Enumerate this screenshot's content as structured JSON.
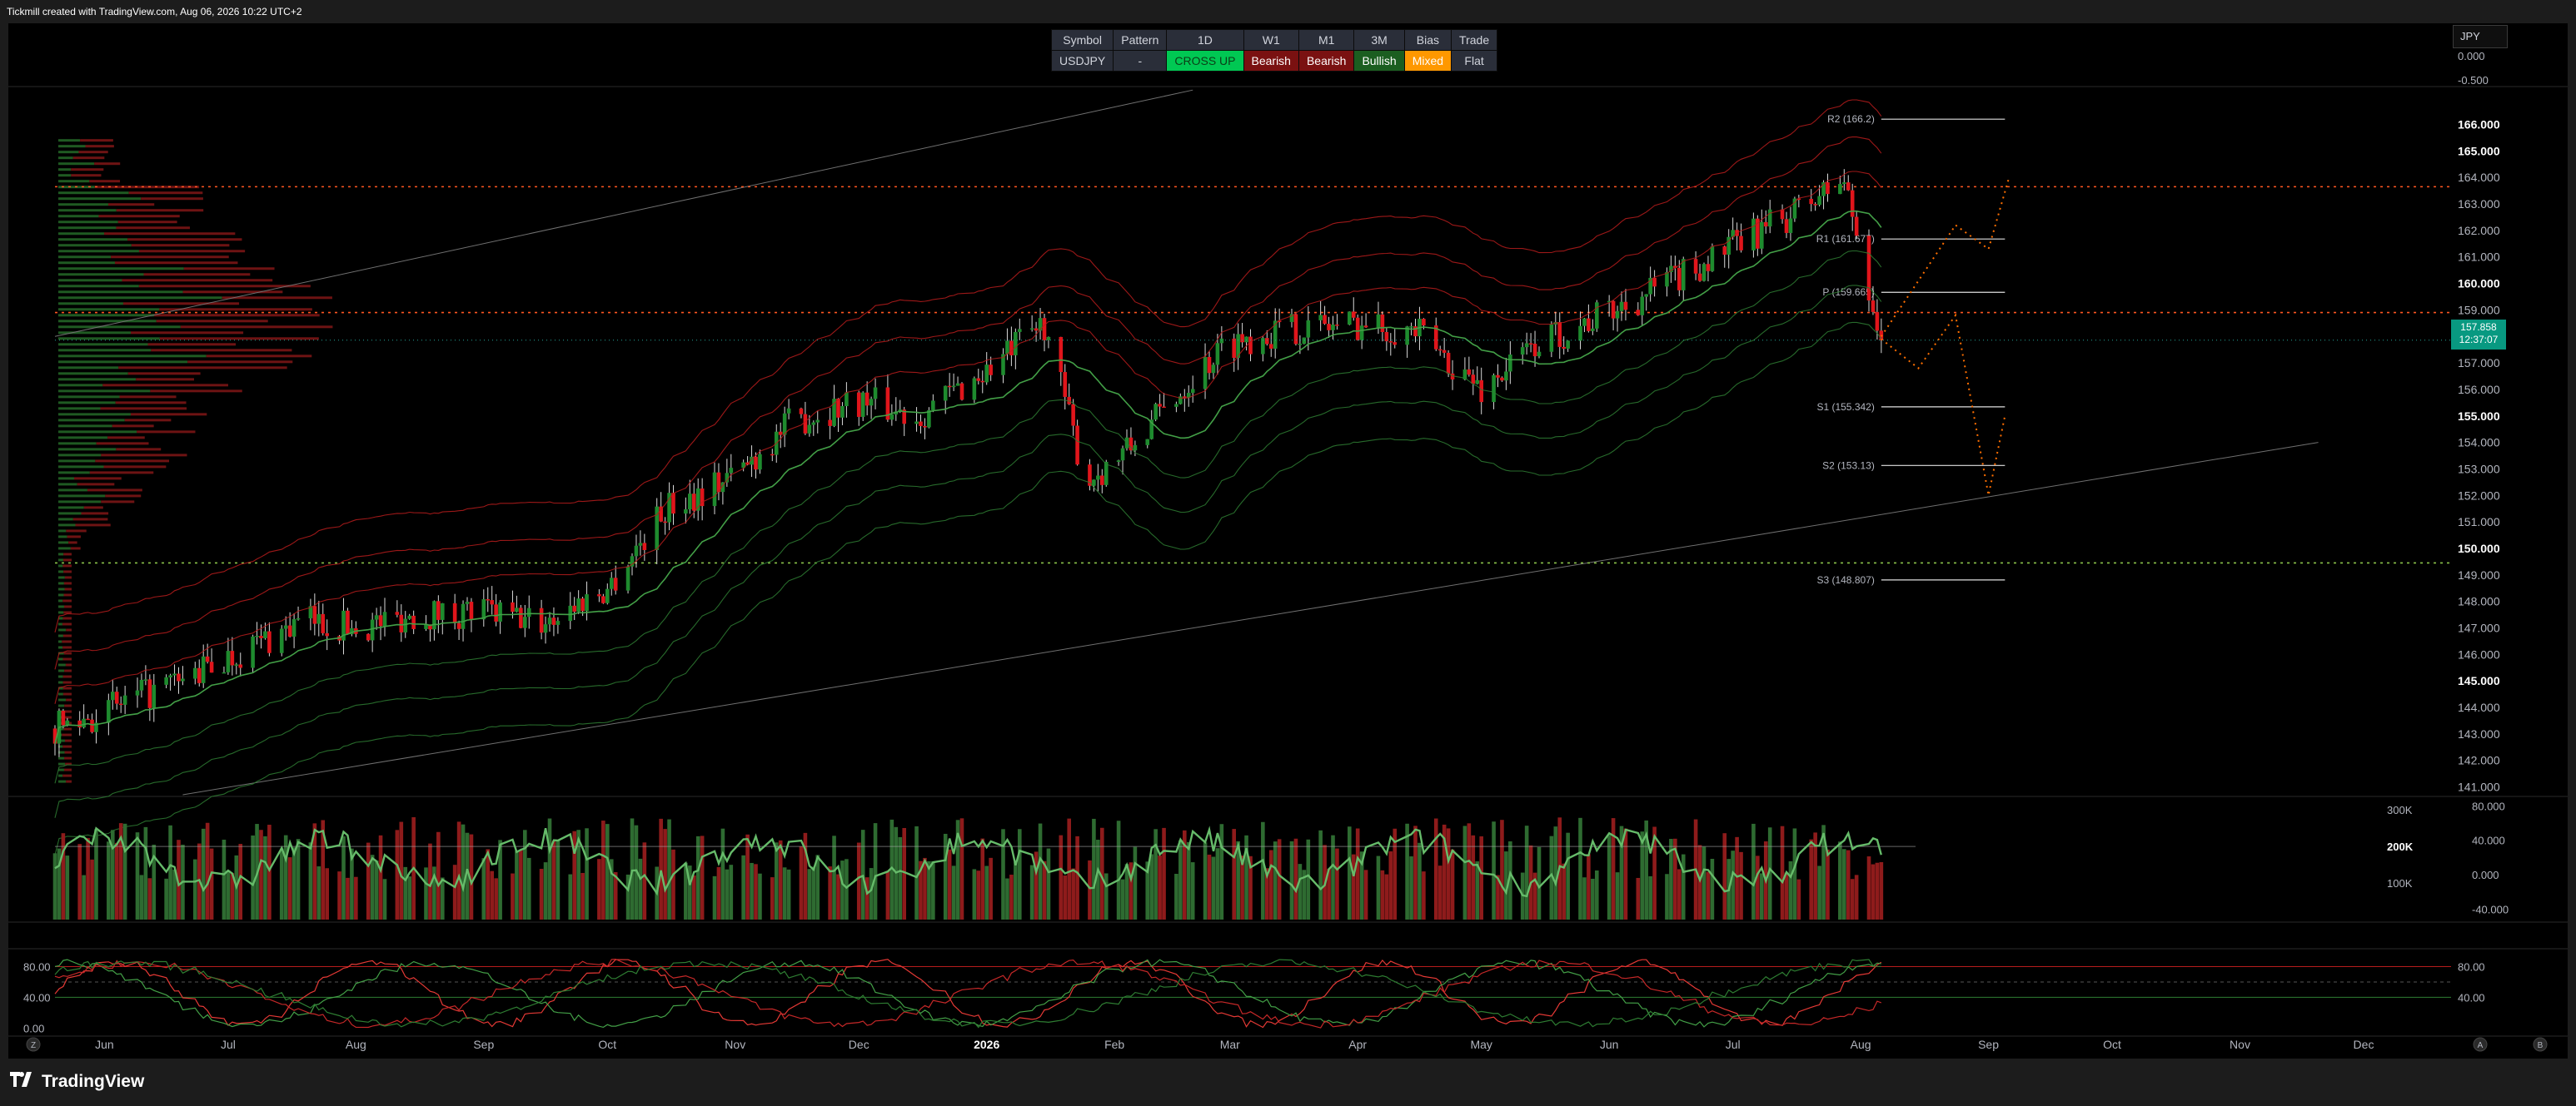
{
  "header": {
    "caption": "Tickmill created with TradingView.com, Aug 06, 2026 10:22 UTC+2"
  },
  "footer": {
    "brand": "TradingView"
  },
  "summary_table": {
    "headers": [
      "Symbol",
      "Pattern",
      "1D",
      "W1",
      "M1",
      "3M",
      "Bias",
      "Trade"
    ],
    "row": [
      "USDJPY",
      "-",
      "CROSS UP",
      "Bearish",
      "Bearish",
      "Bullish",
      "Mixed",
      "Flat"
    ],
    "cell_colors": [
      "#2a2e39",
      "#2a2e39",
      "#00c853",
      "#7a1111",
      "#7a1111",
      "#1b5e20",
      "#ff9800",
      "#2a2e39"
    ],
    "cell_text_colors": [
      "#d1d4dc",
      "#d1d4dc",
      "#0b3d17",
      "#ffffff",
      "#ffffff",
      "#ffffff",
      "#ffffff",
      "#d1d4dc"
    ]
  },
  "currency_label": "JPY",
  "price_tag": {
    "price": "157.858",
    "countdown": "12:37:07"
  },
  "colors": {
    "background": "#000000",
    "bull": "#26a69a",
    "candle_up": "#1e8b2e",
    "candle_down": "#e0151b",
    "band_red": "#b71c1c",
    "band_green": "#2e7d32",
    "resistance_line": "#ff5722",
    "support_line": "#8bc34a",
    "projection": "#ff6f00"
  },
  "chart_data": [
    {
      "type": "candlestick",
      "symbol": "USDJPY",
      "timeframe": "1D",
      "x_ticks": [
        "Jun",
        "Jul",
        "Aug",
        "Sep",
        "Oct",
        "Nov",
        "Dec",
        "2026",
        "Feb",
        "Mar",
        "Apr",
        "May",
        "Jun",
        "Jul",
        "Aug",
        "Sep",
        "Oct",
        "Nov",
        "Dec"
      ],
      "y_ticks": [
        "166.000",
        "165.000",
        "164.000",
        "163.000",
        "162.000",
        "161.000",
        "160.000",
        "159.000",
        "158.000",
        "157.000",
        "156.000",
        "155.000",
        "154.000",
        "153.000",
        "152.000",
        "151.000",
        "150.000",
        "149.000",
        "148.000",
        "147.000",
        "146.000",
        "145.000",
        "144.000",
        "143.000",
        "142.000",
        "141.000"
      ],
      "y_tick_values": [
        166,
        165,
        164,
        163,
        162,
        161,
        160,
        159,
        158,
        157,
        156,
        155,
        154,
        153,
        152,
        151,
        150,
        149,
        148,
        147,
        146,
        145,
        144,
        143,
        142,
        141
      ],
      "y_tick_bold": [
        166.0,
        165.0,
        160.0,
        155.0,
        150.0,
        145.0
      ],
      "ylim": [
        140.7,
        167.4
      ],
      "price_path": {
        "dates": [
          "2025-05-20",
          "2025-06-05",
          "2025-06-20",
          "2025-07-05",
          "2025-07-20",
          "2025-08-01",
          "2025-08-15",
          "2025-09-01",
          "2025-09-15",
          "2025-10-01",
          "2025-10-15",
          "2025-11-01",
          "2025-11-15",
          "2025-12-01",
          "2025-12-15",
          "2026-01-01",
          "2026-01-15",
          "2026-01-25",
          "2026-02-05",
          "2026-02-20",
          "2026-03-01",
          "2026-03-15",
          "2026-04-01",
          "2026-04-15",
          "2026-05-01",
          "2026-05-15",
          "2026-06-01",
          "2026-06-15",
          "2026-07-01",
          "2026-07-15",
          "2026-07-28",
          "2026-08-06"
        ],
        "close": [
          143.2,
          144.1,
          145.0,
          146.2,
          147.3,
          147.0,
          147.5,
          147.6,
          147.2,
          148.5,
          151.5,
          152.8,
          154.8,
          155.6,
          155.0,
          156.7,
          158.5,
          152.5,
          153.8,
          156.5,
          157.8,
          158.3,
          158.5,
          158.2,
          156.0,
          157.8,
          158.9,
          160.0,
          161.4,
          162.6,
          163.9,
          157.86
        ]
      },
      "last_price": 157.858,
      "horizontal_levels": [
        {
          "label": "R2 (166.2)",
          "value": 166.2
        },
        {
          "label": "R1 (161.677)",
          "value": 161.677
        },
        {
          "label": "P (159.665)",
          "value": 159.665
        },
        {
          "label": "S1 (155.342)",
          "value": 155.342
        },
        {
          "label": "S2 (153.13)",
          "value": 153.13
        },
        {
          "label": "S3 (148.807)",
          "value": 148.807
        }
      ],
      "key_levels": [
        {
          "kind": "resistance",
          "value": 163.65
        },
        {
          "kind": "resistance",
          "value": 158.9
        },
        {
          "kind": "support",
          "value": 149.45
        }
      ],
      "channel": {
        "upper": [
          {
            "date": "2025-05-20",
            "value": 158.0
          },
          {
            "date": "2026-02-20",
            "value": 167.3
          }
        ],
        "lower": [
          {
            "date": "2025-06-20",
            "value": 140.7
          },
          {
            "date": "2026-11-20",
            "value": 154.0
          }
        ]
      },
      "projection_path": {
        "dates": [
          "2026-08-06",
          "2026-08-15",
          "2026-08-24",
          "2026-09-01",
          "2026-09-05"
        ],
        "values": [
          157.9,
          156.8,
          158.8,
          152.0,
          155.0
        ]
      },
      "projection_path_alt": {
        "dates": [
          "2026-08-06",
          "2026-08-24",
          "2026-09-01",
          "2026-09-06"
        ],
        "values": [
          158.0,
          162.2,
          161.3,
          164.0
        ]
      }
    },
    {
      "type": "bar",
      "name": "volume",
      "y_ticks": [
        "300K",
        "200K",
        "100K"
      ],
      "y_tick_values": [
        300000,
        200000,
        100000
      ],
      "y_tick_bold": [
        200000
      ],
      "ylim": [
        0,
        330000
      ],
      "oscillator_ticks": [
        "80.000",
        "40.000",
        "0.000",
        "-40.000"
      ],
      "oscillator_tick_values": [
        80,
        40,
        0,
        -40
      ],
      "oscillator_ylim": [
        -52,
        88
      ]
    },
    {
      "type": "line",
      "name": "stochastic",
      "y_ticks_left": [
        "80.00",
        "40.00",
        "0.00"
      ],
      "y_tick_values_left": [
        80,
        40,
        0
      ],
      "y_ticks_right": [
        "80.00",
        "40.00"
      ],
      "y_tick_values_right": [
        80,
        40
      ],
      "ylim": [
        -5,
        100
      ]
    }
  ],
  "top_axis": {
    "ticks": [
      "0.000",
      "-0.500"
    ],
    "tick_values": [
      0,
      -0.5
    ]
  },
  "time_axis_buttons": {
    "left": "Z",
    "right_a": "A",
    "right_b": "B"
  }
}
